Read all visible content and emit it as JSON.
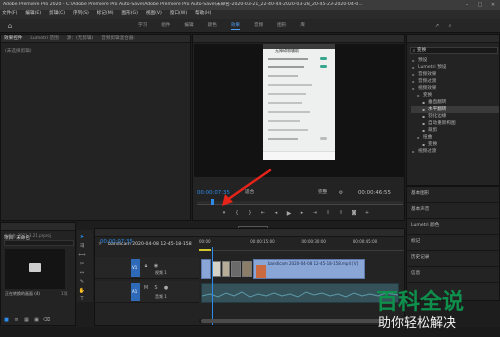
{
  "titlebar": {
    "title": "Adobe Premiere Pro 2020 - C:\\Adobe Premiere Pro Auto-Save\\Adobe Premiere Pro Auto-Save\\未命名-2020-03-21_22-40-44-2020-03-28_20-45-23-2020-04-0..."
  },
  "menu": {
    "items": [
      "文件(F)",
      "编辑(E)",
      "剪辑(C)",
      "序列(S)",
      "标记(M)",
      "图形(G)",
      "视图(V)",
      "窗口(W)",
      "帮助(H)"
    ]
  },
  "workspaces": {
    "tabs": [
      "学习",
      "组件",
      "编辑",
      "颜色",
      "效果",
      "音频",
      "图形",
      "库"
    ],
    "active_index": 4
  },
  "source_panel": {
    "tabs": [
      "效果控件",
      "Lumetri 范围",
      "源：(无剪辑)",
      "音频剪辑混合器:"
    ],
    "empty_text": "(未选择剪辑)"
  },
  "program_monitor": {
    "tab": "节目: bandicam 2020-04-08 12-45-18-158",
    "timecode_current": "00:00:07:35",
    "fit_label": "适合",
    "quality_label": "完整",
    "timecode_total": "00:00:46:55",
    "phone_title": "无障碍和辅助",
    "tooltip": "添加标记 (M)"
  },
  "effects_panel": {
    "tab": "效果",
    "search_value": "变换",
    "tree": [
      {
        "label": "预设",
        "indent": 0,
        "folder": true
      },
      {
        "label": "Lumetri 预设",
        "indent": 0,
        "folder": true
      },
      {
        "label": "音频效果",
        "indent": 0,
        "folder": true
      },
      {
        "label": "音频过渡",
        "indent": 0,
        "folder": true
      },
      {
        "label": "视频效果",
        "indent": 0,
        "folder": true
      },
      {
        "label": "变换",
        "indent": 1,
        "folder": true
      },
      {
        "label": "垂直翻转",
        "indent": 2,
        "folder": false
      },
      {
        "label": "水平翻转",
        "indent": 2,
        "folder": false,
        "selected": true
      },
      {
        "label": "羽化边缘",
        "indent": 2,
        "folder": false
      },
      {
        "label": "自动重新构图",
        "indent": 2,
        "folder": false
      },
      {
        "label": "裁剪",
        "indent": 2,
        "folder": false
      },
      {
        "label": "扭曲",
        "indent": 1,
        "folder": true
      },
      {
        "label": "变换",
        "indent": 2,
        "folder": false
      },
      {
        "label": "视频过渡",
        "indent": 0,
        "folder": true
      }
    ],
    "sections": [
      "基本图形",
      "基本声音",
      "Lumetri 颜色",
      "标记",
      "历史记录",
      "信息"
    ]
  },
  "project_panel": {
    "tab": "项目: 未命名",
    "file": "未命名-2021.3.21.prproj",
    "item_label": "正在转换的画面 (4)",
    "count": "1项"
  },
  "timeline": {
    "tab": "bandicam 2020-04-08 12-45-18-158",
    "timecode": "00:00:07:35",
    "ruler": [
      "00:00",
      "00:00:15:00",
      "00:00:30:00",
      "00:00:45:00"
    ],
    "video_tracks": [
      {
        "id": "V1",
        "name": "视频 1"
      }
    ],
    "audio_tracks": [
      {
        "id": "A1",
        "name": "音频 1"
      }
    ],
    "clip_label": "bandicam 2020-04-08 12-45-18-158.mp4 [V]"
  },
  "watermark": {
    "title": "百科全说",
    "subtitle": "助你轻松解决"
  }
}
